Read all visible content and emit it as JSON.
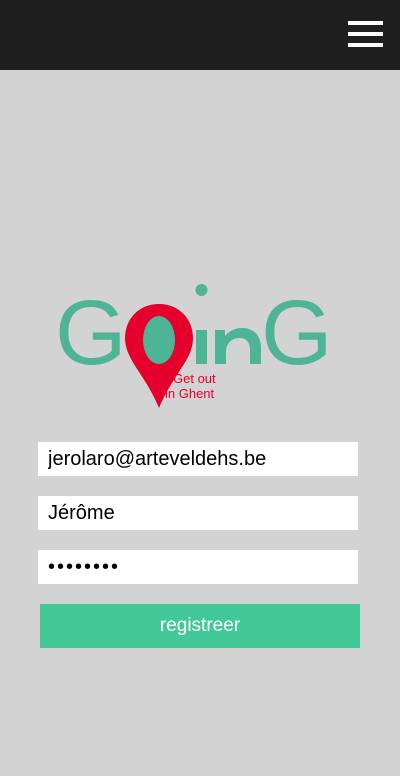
{
  "header": {
    "menu_icon": "hamburger-menu-icon"
  },
  "logo": {
    "wordmark": "GoinG",
    "tagline_line1": "Get out",
    "tagline_line2": "in Ghent",
    "colors": {
      "green": "#4db595",
      "red": "#e4002b"
    }
  },
  "form": {
    "email_value": "jerolaro@arteveldehs.be",
    "name_value": "Jérôme",
    "password_value": "12345678",
    "submit_label": "registreer"
  },
  "colors": {
    "topbar": "#1f1f1f",
    "background": "#d3d3d3",
    "button": "#43c998"
  }
}
